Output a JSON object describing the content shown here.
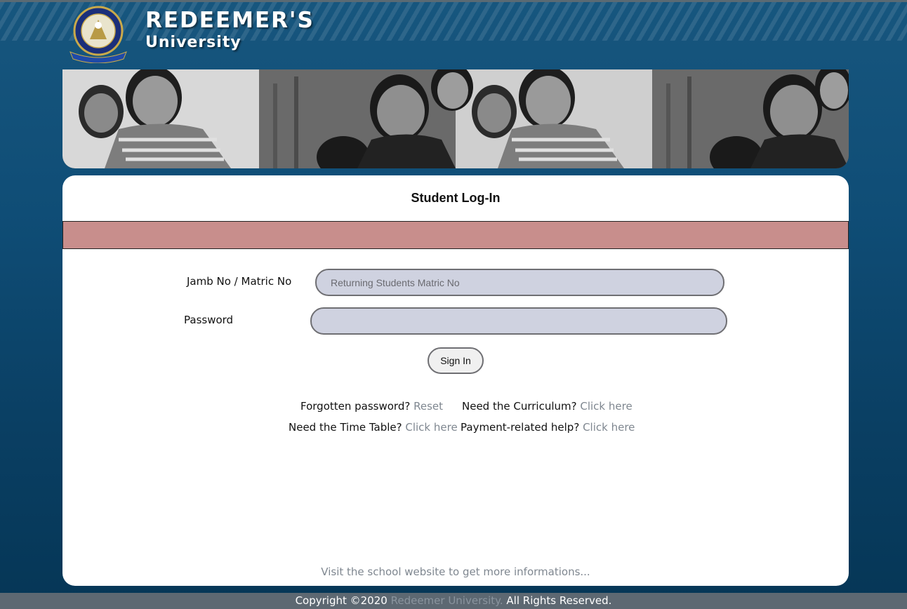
{
  "header": {
    "brand_name": "REDEEMER'S",
    "brand_sub": "University"
  },
  "banner": {
    "photo": "black-and-white photo of smiling children"
  },
  "login": {
    "title": "Student Log-In",
    "id_label": "Jamb No / Matric No",
    "id_placeholder": "Returning Students Matric No",
    "id_value": "",
    "password_label": "Password",
    "password_value": "",
    "signin_label": "Sign In"
  },
  "help": {
    "forgot_text": "Forgotten password?",
    "forgot_link": "Reset",
    "curriculum_text": "Need the Curriculum?",
    "curriculum_link": "Click here",
    "timetable_text": "Need the Time Table?",
    "timetable_link": "Click here",
    "payment_text": "Payment-related help?",
    "payment_link": "Click here"
  },
  "visit_text": "Visit the school website to get more informations...",
  "footer": {
    "prefix": "Copyright ©2020",
    "link": "Redeemer University.",
    "suffix": "All Rights Reserved."
  },
  "colors": {
    "background": "#0f4d76",
    "alert_bar": "#c88e8c",
    "input_bg": "#cfd2e0",
    "link": "#7f8790",
    "footer": "#5d6872"
  }
}
